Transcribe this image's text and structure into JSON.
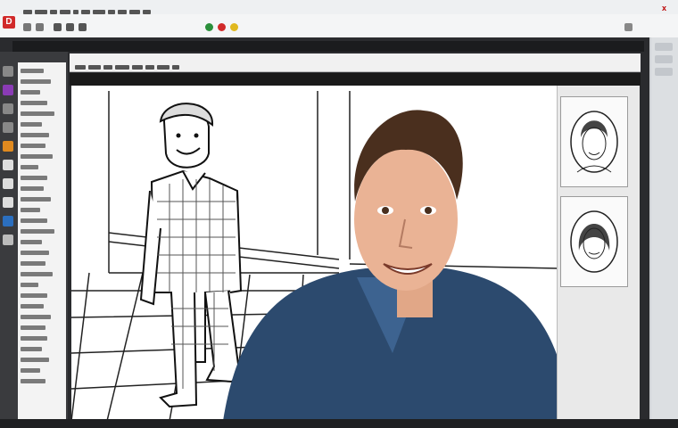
{
  "app": {
    "logo_text": "D",
    "close_glyph": "x"
  },
  "icons": {
    "outer_toolbar": [
      "app-icon",
      "undo-icon",
      "redo-icon",
      "brush-icon",
      "pen-icon",
      "eraser-icon",
      "color-red-icon",
      "color-green-icon",
      "color-yellow-icon",
      "settings-icon"
    ],
    "dock": [
      "move-icon",
      "select-icon",
      "lasso-icon",
      "brush-tool-icon",
      "paint-bucket-icon",
      "eyedropper-icon",
      "text-icon",
      "shape-icon",
      "zoom-icon",
      "hand-icon"
    ]
  },
  "colors": {
    "brand": "#d12a2a",
    "dock_bg": "#3a3b3e",
    "canvas_bg": "#ffffff",
    "accent_blue": "#2b6fbf",
    "accent_orange": "#e08a1f"
  },
  "canvas": {
    "subject": "line-art-cartoon-man",
    "overlay": "webcam-photo"
  },
  "reference_panel": {
    "cards": [
      "portrait-sketch-man",
      "portrait-sketch-woman"
    ]
  }
}
